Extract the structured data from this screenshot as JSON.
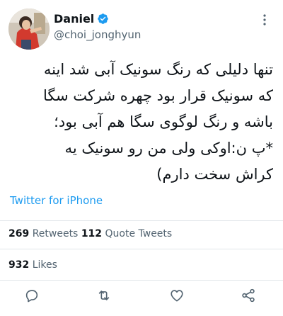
{
  "user": {
    "display_name": "Daniel",
    "handle": "@choi_jonghyun",
    "verified": true
  },
  "tweet": {
    "text": "تنها دلیلی که رنگ سونیک آبی شد اینه\nکه سونیک قرار بود چهره شرکت سگا\nباشه و رنگ لوگوی سگا هم آبی بود؛\n*پ ن:اوکی ولی من رو سونیک یه\nکراش سخت دارم)",
    "source": "Twitter for iPhone"
  },
  "stats": {
    "retweets_count": "269",
    "retweets_label": "Retweets",
    "quote_count": "112",
    "quote_label": "Quote Tweets",
    "likes_count": "932",
    "likes_label": "Likes"
  },
  "actions": {
    "icons": [
      "reply-icon",
      "retweet-icon",
      "like-icon",
      "share-icon"
    ]
  },
  "colors": {
    "link": "#1d9bf0",
    "secondary_text": "#536471",
    "verified": "#1d9bf0",
    "divider": "#e1e6ea"
  }
}
